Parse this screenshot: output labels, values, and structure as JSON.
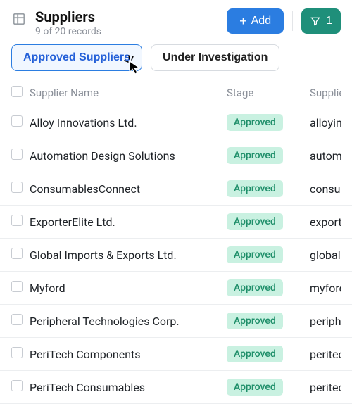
{
  "header": {
    "title": "Suppliers",
    "subtitle": "9 of 20 records",
    "add_label": "Add",
    "filter_count": "1"
  },
  "tabs": {
    "approved": "Approved Suppliers",
    "investigation": "Under Investigation"
  },
  "columns": {
    "name": "Supplier Name",
    "stage": "Stage",
    "website": "Supplier We"
  },
  "stage_label": "Approved",
  "rows": [
    {
      "name": "Alloy Innovations Ltd.",
      "website": "alloyinnova"
    },
    {
      "name": "Automation Design Solutions",
      "website": "automation"
    },
    {
      "name": "ConsumablesConnect",
      "website": "consumabl"
    },
    {
      "name": "ExporterElite Ltd.",
      "website": "exportereli"
    },
    {
      "name": "Global Imports & Exports Ltd.",
      "website": "globalexpo"
    },
    {
      "name": "Myford",
      "website": "myford.co."
    },
    {
      "name": "Peripheral Technologies Corp.",
      "website": "peripheralt"
    },
    {
      "name": "PeriTech Components",
      "website": "peritechco"
    },
    {
      "name": "PeriTech Consumables",
      "website": "peritechco"
    }
  ]
}
